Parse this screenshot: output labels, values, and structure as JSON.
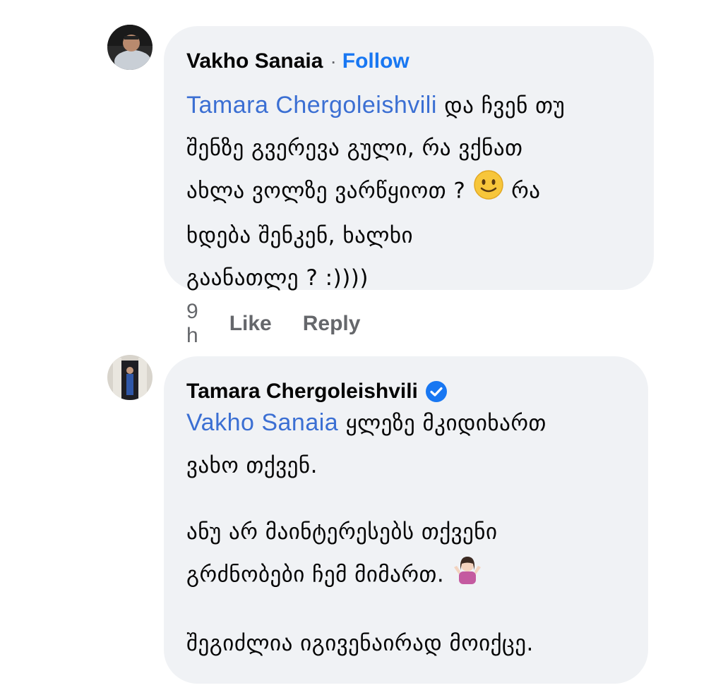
{
  "comments": [
    {
      "author": "Vakho Sanaia",
      "separator": "·",
      "follow_label": "Follow",
      "mention": "Tamara Chergoleishvili",
      "lines": [
        "და ჩვენ თუ",
        "შენზე გვერევა გული, რა ვქნათ",
        "ახლა ვოლზე ვარწყიოთ ?",
        "რა",
        "ხდება შენკენ, ხალხი",
        "გაანათლე ? :))))"
      ],
      "emoji": "slightly-smiling-face-icon",
      "time": "9 h",
      "like_label": "Like",
      "reply_label": "Reply"
    },
    {
      "author": "Tamara Chergoleishvili",
      "verified": true,
      "mention": "Vakho Sanaia",
      "lines": [
        "ყლეზე მკიდიხართ",
        "ვახო თქვენ.",
        "ანუ არ მაინტერესებს თქვენი",
        "გრძნობები ჩემ მიმართ.",
        "შეგიძლია იგივენაირად მოიქცე."
      ],
      "emoji": "person-shrugging-icon"
    }
  ],
  "colors": {
    "bubble": "#f0f2f5",
    "link": "#3b6fd3",
    "follow": "#1877f2",
    "meta": "#65676b"
  }
}
